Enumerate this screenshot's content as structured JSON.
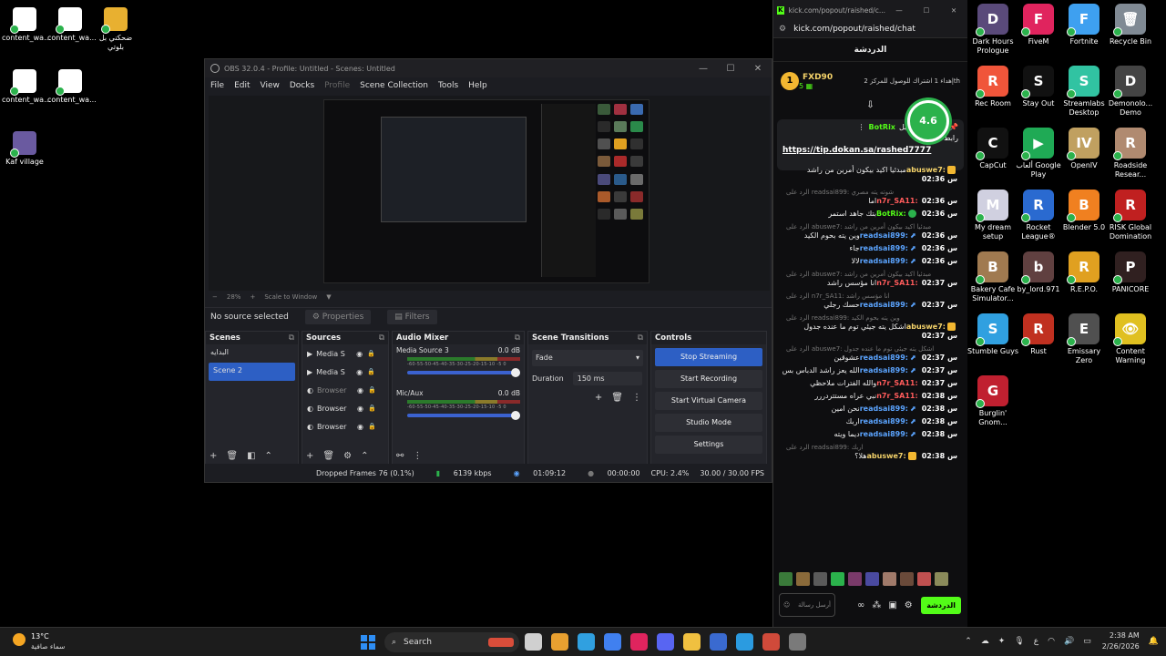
{
  "desktop_left": [
    {
      "label": "content_wa...",
      "color": "#ffffff"
    },
    {
      "label": "content_wa...",
      "color": "#ffffff"
    },
    {
      "label": "ضحكني بل بلوتي",
      "color": "#e8b030"
    },
    {
      "label": "content_wa...",
      "color": "#ffffff"
    },
    {
      "label": "content_wa...",
      "color": "#ffffff"
    },
    {
      "label": "Kaf village",
      "color": "#6a5aa0"
    }
  ],
  "desktop_right": [
    {
      "label": "Dark Hours Prologue",
      "color": "#5a4a7a",
      "glyph": "D"
    },
    {
      "label": "FiveM",
      "color": "#e0245e",
      "glyph": "F"
    },
    {
      "label": "Fortnite",
      "color": "#3ea0f0",
      "glyph": "F"
    },
    {
      "label": "Recycle Bin",
      "color": "#808a94",
      "glyph": "🗑"
    },
    {
      "label": "Rec Room",
      "color": "#f0553a",
      "glyph": "R"
    },
    {
      "label": "Stay Out",
      "color": "#111111",
      "glyph": "S"
    },
    {
      "label": "Streamlabs Desktop",
      "color": "#31c3a2",
      "glyph": "S"
    },
    {
      "label": "Demonolo... Demo",
      "color": "#444444",
      "glyph": "D"
    },
    {
      "label": "CapCut",
      "color": "#111111",
      "glyph": "C"
    },
    {
      "label": "ألعاب Google Play",
      "color": "#1faa55",
      "glyph": "▶"
    },
    {
      "label": "OpenIV",
      "color": "#c0a060",
      "glyph": "IV"
    },
    {
      "label": "Roadside Resear...",
      "color": "#b08a70",
      "glyph": "R"
    },
    {
      "label": "My dream setup",
      "color": "#d0d0e0",
      "glyph": "M"
    },
    {
      "label": "Rocket League®",
      "color": "#2a6ad0",
      "glyph": "R"
    },
    {
      "label": "Blender 5.0",
      "color": "#f08020",
      "glyph": "B"
    },
    {
      "label": "RISK Global Domination",
      "color": "#c02020",
      "glyph": "R"
    },
    {
      "label": "Bakery Cafe Simulator...",
      "color": "#a07a50",
      "glyph": "B"
    },
    {
      "label": "by_lord.971",
      "color": "#604040",
      "glyph": "b"
    },
    {
      "label": "R.E.P.O.",
      "color": "#e0a020",
      "glyph": "R"
    },
    {
      "label": "PANICORE",
      "color": "#302020",
      "glyph": "P"
    },
    {
      "label": "Stumble Guys",
      "color": "#30a0e0",
      "glyph": "S"
    },
    {
      "label": "Rust",
      "color": "#c03020",
      "glyph": "R"
    },
    {
      "label": "Emissary Zero",
      "color": "#505050",
      "glyph": "E"
    },
    {
      "label": "Content Warning",
      "color": "#e0c020",
      "glyph": "👁"
    },
    {
      "label": "Burglin' Gnom...",
      "color": "#c02030",
      "glyph": "G"
    }
  ],
  "obs": {
    "title": "OBS 32.0.4 - Profile: Untitled - Scenes: Untitled",
    "menu": [
      "File",
      "Edit",
      "View",
      "Docks",
      "Profile",
      "Scene Collection",
      "Tools",
      "Help"
    ],
    "zoom": "28%",
    "zoom_mode": "Scale to Window",
    "no_source": "No source selected",
    "properties": "Properties",
    "filters": "Filters",
    "scenes_title": "Scenes",
    "scenes": [
      "البدايه",
      "Scene 2"
    ],
    "sources_title": "Sources",
    "sources": [
      {
        "name": "Media S",
        "dim": false
      },
      {
        "name": "Media S",
        "dim": false
      },
      {
        "name": "Browser",
        "dim": true
      },
      {
        "name": "Browser",
        "dim": false
      },
      {
        "name": "Browser",
        "dim": false
      }
    ],
    "mixer_title": "Audio Mixer",
    "mixer": [
      {
        "name": "Media Source 3",
        "db": "0.0 dB"
      },
      {
        "name": "Mic/Aux",
        "db": "0.0 dB"
      }
    ],
    "meter_scale": "-60-55-50-45-40-35-30-25-20-15-10 -5 0",
    "transitions_title": "Scene Transitions",
    "transition": "Fade",
    "duration_label": "Duration",
    "duration_value": "150 ms",
    "controls_title": "Controls",
    "controls": [
      "Stop Streaming",
      "Start Recording",
      "Start Virtual Camera",
      "Studio Mode",
      "Settings"
    ],
    "status": {
      "dropped": "Dropped Frames 76 (0.1%)",
      "bitrate": "6139 kbps",
      "stream_time": "01:09:12",
      "rec_time": "00:00:00",
      "cpu": "CPU: 2.4%",
      "fps": "30.00 / 30.00 FPS"
    }
  },
  "chat": {
    "tab_title": "kick.com/popout/raished/c...",
    "url": "kick.com/popout/raished/chat",
    "header": "الدردشة",
    "leader_name": "FXD90",
    "leader_count": "5",
    "leader_info": "إهداء 1 اشتراك للوصول للمركز 2th",
    "pin_by": "أرسلت من قبل",
    "pin_user": "BotRix",
    "pin_title": "رابط الدعم",
    "pin_link": "https://tip.dokan.sa/rashed7777",
    "rating": "4.6",
    "messages": [
      {
        "time": "02:36 س",
        "user": "abuswe7:",
        "uclass": "u-yellow",
        "badge": "b-gold",
        "text": "مبدئيا اكيد بيكون أمرين من راشد",
        "reply": ""
      },
      {
        "time": "02:36 س",
        "user": "n7r_SA11:",
        "uclass": "u-red",
        "badge": "",
        "text": "اما",
        "reply": "الرد على readsai899: شوته يته مصري"
      },
      {
        "time": "02:36 س",
        "user": "BotRix:",
        "uclass": "u-green",
        "badge": "b-green",
        "text": "بتك جاهد استمر",
        "reply": ""
      },
      {
        "time": "02:36 س",
        "user": "readsai899:",
        "uclass": "u-blue",
        "badge": "b-fish",
        "text": "وين يته بحوم الكيد",
        "reply": "الرد على abuswe7: مبدئيا اكيد بيكون أمرين من راشد"
      },
      {
        "time": "02:36 س",
        "user": "readsai899:",
        "uclass": "u-blue",
        "badge": "b-fish",
        "text": "جاء",
        "reply": ""
      },
      {
        "time": "02:36 س",
        "user": "readsai899:",
        "uclass": "u-blue",
        "badge": "b-fish",
        "text": "لالا",
        "reply": ""
      },
      {
        "time": "02:37 س",
        "user": "n7r_SA11:",
        "uclass": "u-red",
        "badge": "",
        "text": "انا مؤسس راشد",
        "reply": "الرد على abuswe7: مبدئيا اكيد بيكون أمرين من راشد"
      },
      {
        "time": "02:37 س",
        "user": "readsai899:",
        "uclass": "u-blue",
        "badge": "b-fish",
        "text": "حسك رجلي",
        "reply": "الرد على n7r_SA11: انا مؤسس راشد"
      },
      {
        "time": "02:37 س",
        "user": "abuswe7:",
        "uclass": "u-yellow",
        "badge": "b-gold",
        "text": "اشكل يته جيئي توم ما عنده جدول",
        "reply": "الرد على readsai899: وين يته بحوم الكيد"
      },
      {
        "time": "02:37 س",
        "user": "readsai899:",
        "uclass": "u-blue",
        "badge": "b-fish",
        "text": "عشوقين",
        "reply": "الرد على abuswe7: اشكل يته جيئي توم ما عنده جدول"
      },
      {
        "time": "02:37 س",
        "user": "readsai899:",
        "uclass": "u-blue",
        "badge": "b-fish",
        "text": "الله يعز راشد الدباس بس",
        "reply": ""
      },
      {
        "time": "02:37 س",
        "user": "n7r_SA11:",
        "uclass": "u-red",
        "badge": "",
        "text": "والله الفترات ملاحظي",
        "reply": ""
      },
      {
        "time": "02:38 س",
        "user": "n7r_SA11:",
        "uclass": "u-red",
        "badge": "",
        "text": "نبي عراه مستتردررر",
        "reply": ""
      },
      {
        "time": "02:38 س",
        "user": "readsai899:",
        "uclass": "u-blue",
        "badge": "b-fish",
        "text": "نحن امين",
        "reply": ""
      },
      {
        "time": "02:38 س",
        "user": "readsai899:",
        "uclass": "u-blue",
        "badge": "b-fish",
        "text": "اربك",
        "reply": ""
      },
      {
        "time": "02:38 س",
        "user": "readsai899:",
        "uclass": "u-blue",
        "badge": "b-fish",
        "text": "ديما ويته",
        "reply": ""
      },
      {
        "time": "02:38 س",
        "user": "abuswe7:",
        "uclass": "u-yellow",
        "badge": "b-gold",
        "text": "هلا؟",
        "reply": "الرد على readsai899: اربك"
      }
    ],
    "emote_colors": [
      "#3a7a3a",
      "#8a6a3a",
      "#5a5a5a",
      "#2bb24c",
      "#7a3a6a",
      "#4a4aa0",
      "#a07a6a",
      "#6a4a3a",
      "#c05050",
      "#8a8a5a"
    ],
    "input_placeholder": "أرسل رسالة",
    "send": "الدردشة"
  },
  "taskbar": {
    "temp": "13°C",
    "weather": "سماء صافية",
    "search": "Search",
    "apps": [
      "#d0d0d0",
      "#e8a030",
      "#30a0e0",
      "#4080f0",
      "#e0245e",
      "#5865f2",
      "#f0c040",
      "#3a6ad0",
      "#2b9be0",
      "#d04a3a",
      "#7a7a7a"
    ],
    "lang": "ع",
    "time": "2:38 AM",
    "date": "2/26/2026"
  }
}
